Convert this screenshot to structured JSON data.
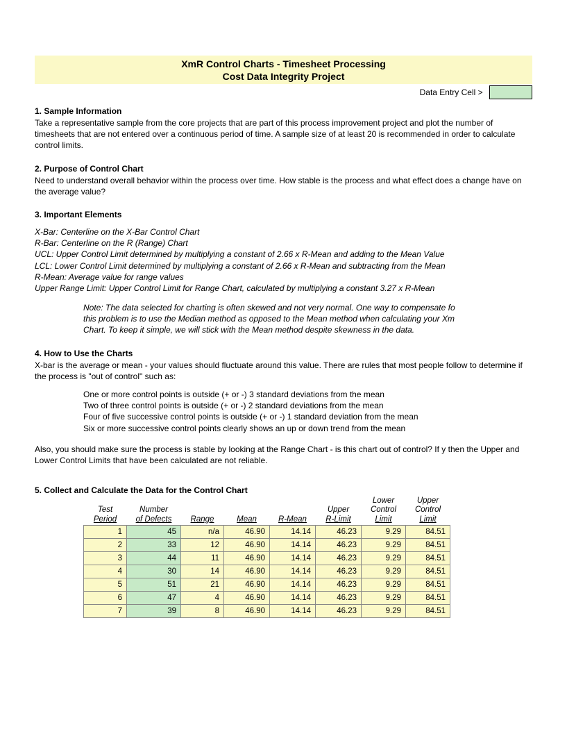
{
  "title": {
    "line1": "XmR Control Charts - Timesheet Processing",
    "line2": "Cost Data Integrity Project"
  },
  "dataEntry": {
    "label": "Data Entry Cell >"
  },
  "s1": {
    "heading": "1. Sample Information",
    "text": "Take a representative sample from the core projects that are part of this process improvement project and plot the number of timesheets that are not entered over a continuous period of time.  A sample size of at least 20 is recommended in order to calculate control limits."
  },
  "s2": {
    "heading": "2. Purpose of Control Chart",
    "text": "Need to understand overall behavior within the process over time. How stable is the process and what effect does a change have on the average value?"
  },
  "s3": {
    "heading": "3. Important Elements",
    "l1": "X-Bar: Centerline on the X-Bar Control Chart",
    "l2": "R-Bar: Centerline on the R (Range) Chart",
    "l3": "UCL: Upper Control Limit determined by multiplying a constant of 2.66 x R-Mean and adding to the Mean Value",
    "l4": "LCL: Lower Control Limit determined by multiplying a constant of 2.66 x R-Mean and subtracting from the Mean",
    "l5": "R-Mean: Average value for range values",
    "l6": "Upper Range Limit: Upper Control Limit for Range Chart, calculated by multiplying a constant 3.27 x R-Mean",
    "note1": "Note: The data selected for charting is often skewed and not very normal. One way to compensate fo",
    "note2": "this problem is to use the Median method as opposed to the Mean method when calculating your Xm",
    "note3": "Chart. To keep it simple, we will stick with the Mean method despite skewness in the data."
  },
  "s4": {
    "heading": "4. How to Use the Charts",
    "p1": "X-bar is the average or mean - your values should fluctuate around this value. There are rules that most people follow to determine if the process is \"out of control\" such as:",
    "r1": "One or more control points is outside (+ or -) 3 standard deviations from the mean",
    "r2": "Two of three control points is outside (+ or -) 2 standard deviations from the mean",
    "r3": "Four of five successive control points is outside (+ or -) 1 standard deviation from the mean",
    "r4": "Six or more successive control points clearly shows an up or down trend from the mean",
    "p2": "Also, you should make sure the process is stable by looking at the Range Chart - is this chart out of control? If y then the Upper and Lower Control Limits that have been calculated are not reliable."
  },
  "s5": {
    "heading": "5. Collect and Calculate the Data for the Control Chart"
  },
  "table": {
    "headers": {
      "tp1": "Test",
      "tp2": "Period",
      "nd1": "Number",
      "nd2": "of Defects",
      "rg": "Range",
      "mn": "Mean",
      "rm": "R-Mean",
      "ur1": "Upper",
      "ur2": "R-Limit",
      "lcl1": "Lower",
      "lcl2": "Control",
      "lcl3": "Limit",
      "ucl1": "Upper",
      "ucl2": "Control",
      "ucl3": "Limit"
    },
    "rows": [
      {
        "tp": "1",
        "nd": "45",
        "rg": "n/a",
        "mn": "46.90",
        "rm": "14.14",
        "ur": "46.23",
        "lcl": "9.29",
        "ucl": "84.51"
      },
      {
        "tp": "2",
        "nd": "33",
        "rg": "12",
        "mn": "46.90",
        "rm": "14.14",
        "ur": "46.23",
        "lcl": "9.29",
        "ucl": "84.51"
      },
      {
        "tp": "3",
        "nd": "44",
        "rg": "11",
        "mn": "46.90",
        "rm": "14.14",
        "ur": "46.23",
        "lcl": "9.29",
        "ucl": "84.51"
      },
      {
        "tp": "4",
        "nd": "30",
        "rg": "14",
        "mn": "46.90",
        "rm": "14.14",
        "ur": "46.23",
        "lcl": "9.29",
        "ucl": "84.51"
      },
      {
        "tp": "5",
        "nd": "51",
        "rg": "21",
        "mn": "46.90",
        "rm": "14.14",
        "ur": "46.23",
        "lcl": "9.29",
        "ucl": "84.51"
      },
      {
        "tp": "6",
        "nd": "47",
        "rg": "4",
        "mn": "46.90",
        "rm": "14.14",
        "ur": "46.23",
        "lcl": "9.29",
        "ucl": "84.51"
      },
      {
        "tp": "7",
        "nd": "39",
        "rg": "8",
        "mn": "46.90",
        "rm": "14.14",
        "ur": "46.23",
        "lcl": "9.29",
        "ucl": "84.51"
      }
    ]
  },
  "chart_data": {
    "type": "table",
    "title": "XmR Control Chart Data — Timesheet Processing",
    "columns": [
      "Test Period",
      "Number of Defects",
      "Range",
      "Mean",
      "R-Mean",
      "Upper R-Limit",
      "Lower Control Limit",
      "Upper Control Limit"
    ],
    "rows": [
      [
        1,
        45,
        null,
        46.9,
        14.14,
        46.23,
        9.29,
        84.51
      ],
      [
        2,
        33,
        12,
        46.9,
        14.14,
        46.23,
        9.29,
        84.51
      ],
      [
        3,
        44,
        11,
        46.9,
        14.14,
        46.23,
        9.29,
        84.51
      ],
      [
        4,
        30,
        14,
        46.9,
        14.14,
        46.23,
        9.29,
        84.51
      ],
      [
        5,
        51,
        21,
        46.9,
        14.14,
        46.23,
        9.29,
        84.51
      ],
      [
        6,
        47,
        4,
        46.9,
        14.14,
        46.23,
        9.29,
        84.51
      ],
      [
        7,
        39,
        8,
        46.9,
        14.14,
        46.23,
        9.29,
        84.51
      ]
    ]
  }
}
